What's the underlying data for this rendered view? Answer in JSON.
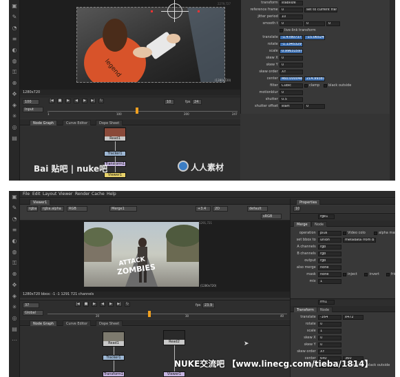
{
  "panel1": {
    "viewer": {
      "res_tl": "2279,727",
      "res_br": "(1280x720)",
      "format": "1280x720"
    },
    "timeline": {
      "frame": "100",
      "playback": "Input",
      "fps_label": "fps",
      "fps": "24",
      "step": "10",
      "ticks": [
        "1",
        "100",
        "200",
        "247"
      ]
    },
    "tabs": [
      "Node Graph",
      "Curve Editor",
      "Dope Sheet"
    ],
    "nodes": [
      "Read1",
      "Tracker1",
      "Transform1",
      "Viewer1"
    ],
    "properties": {
      "rows": [
        {
          "label": "transform",
          "value": "stabilize"
        },
        {
          "label": "reference frame",
          "value": "0",
          "extra": "set to current frame"
        },
        {
          "label": "jitter period",
          "value": "10"
        },
        {
          "label": "smooth t",
          "value": "0",
          "v2": "0",
          "v3": "0"
        },
        {
          "label": "",
          "check": "live-link transform"
        },
        {
          "label": "translate",
          "value": "-1.4780737",
          "v2": "-15.0652403"
        },
        {
          "label": "rotate",
          "value": "-1.1345329"
        },
        {
          "label": "scale",
          "value": "0.99631597"
        },
        {
          "label": "skew X",
          "value": "0"
        },
        {
          "label": "skew Y",
          "value": "0"
        },
        {
          "label": "skew order",
          "value": "XY"
        },
        {
          "label": "center",
          "value": "460.000048",
          "v2": "214.993872"
        },
        {
          "label": "filter",
          "value": "Cubic",
          "check": "clamp",
          "check2": "black outside"
        },
        {
          "label": "motionblur",
          "value": "0"
        },
        {
          "label": "shutter",
          "value": "0.5"
        },
        {
          "label": "shutter offset",
          "value": "start",
          "v2": "0"
        }
      ]
    },
    "watermark_left": "Bai 贴吧 | nuke吧",
    "watermark_right": "人人素材"
  },
  "panel2": {
    "menu": [
      "File",
      "Edit",
      "Layout",
      "Viewer",
      "Render",
      "Cache",
      "Help"
    ],
    "viewer_tab": "Viewer1",
    "viewer_controls": [
      "rgba",
      "rgba.alpha",
      "RGB",
      "Merge1",
      "+3.4",
      "2D",
      "default",
      "sRGB"
    ],
    "viewer": {
      "res_tl": "1291,721",
      "res_br": "(1280x720)",
      "title_line1": "ATTACK",
      "title_line2": "ZOMBIES",
      "info": "1280x720 bbox: -1 -1 1291 721 channels"
    },
    "timeline": {
      "frame": "37",
      "playback": "Global",
      "fps": "23.9",
      "ticks": [
        "20",
        "30",
        "40"
      ]
    },
    "tabs": [
      "Node Graph",
      "Curve Editor",
      "Dope Sheet"
    ],
    "nodes": [
      "Read1",
      "Read2",
      "Tracker1",
      "Transform1",
      "Viewer1"
    ],
    "properties_header": "Properties",
    "merge": {
      "name": "rge1",
      "tabs": [
        "Merge",
        "Node"
      ],
      "rows": [
        {
          "label": "operation",
          "value": "plus",
          "check": "Video colo",
          "check2": "alpha mas"
        },
        {
          "label": "set bbox to",
          "value": "union",
          "extra": "metadata from B"
        },
        {
          "label": "A channels",
          "value": "rgb"
        },
        {
          "label": "B channels",
          "value": "rgb"
        },
        {
          "label": "output",
          "value": "rgb"
        },
        {
          "label": "also merge",
          "value": "none"
        },
        {
          "label": "mask",
          "value": "none",
          "check": "inject",
          "check2": "invert",
          "check3": "fringe"
        },
        {
          "label": "mix",
          "value": "1"
        }
      ]
    },
    "transform": {
      "name": "rm1",
      "tabs": [
        "Transform",
        "Node"
      ],
      "rows": [
        {
          "label": "translate",
          "value": "-164",
          "v2": "x472"
        },
        {
          "label": "rotate",
          "value": "0"
        },
        {
          "label": "scale",
          "value": "1"
        },
        {
          "label": "skew X",
          "value": "0"
        },
        {
          "label": "skew Y",
          "value": "0"
        },
        {
          "label": "skew order",
          "value": "XY"
        },
        {
          "label": "center",
          "value": "640",
          "v2": "360"
        },
        {
          "label": "filter",
          "value": "Cubic",
          "check": "clamp",
          "check2": "black outside"
        }
      ]
    },
    "watermark": "NUKE交流吧 【www.linecg.com/tieba/1814】"
  }
}
